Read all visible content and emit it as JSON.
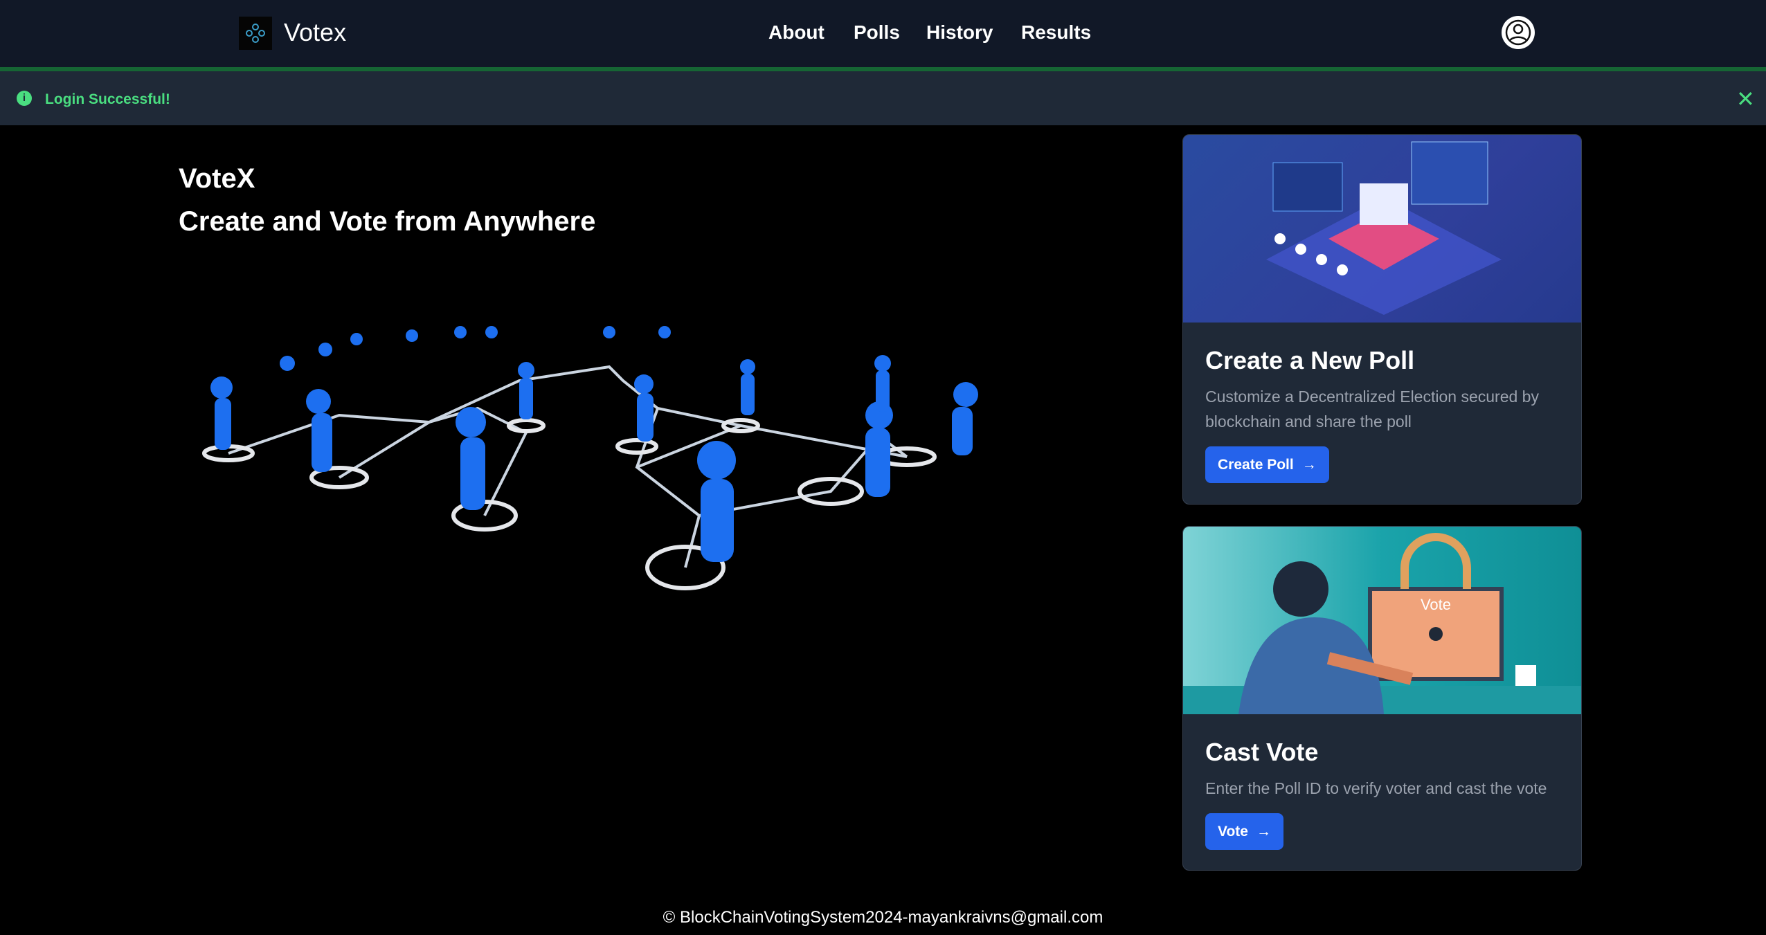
{
  "nav": {
    "brand": "Votex",
    "links": [
      "About",
      "Polls",
      "History",
      "Results"
    ],
    "avatar_icon": "user-circle-icon"
  },
  "alert": {
    "message": "Login Successful!",
    "icon": "info-icon",
    "close_icon": "close-icon",
    "color": "#4ade80"
  },
  "hero": {
    "title": "VoteX",
    "subtitle": "Create and Vote from Anywhere"
  },
  "cards": [
    {
      "title": "Create a New Poll",
      "description": "Customize a Decentralized Election secured by blockchain and share the poll",
      "button": "Create Poll",
      "arrow": "→"
    },
    {
      "title": "Cast Vote",
      "description": "Enter the Poll ID to verify voter and cast the vote",
      "button": "Vote",
      "arrow": "→",
      "image_label": "Vote"
    }
  ],
  "footer": "© BlockChainVotingSystem2024-mayankraivns@gmail.com",
  "colors": {
    "nav": "#111827",
    "accent": "#2563eb",
    "card": "#1f2937"
  }
}
